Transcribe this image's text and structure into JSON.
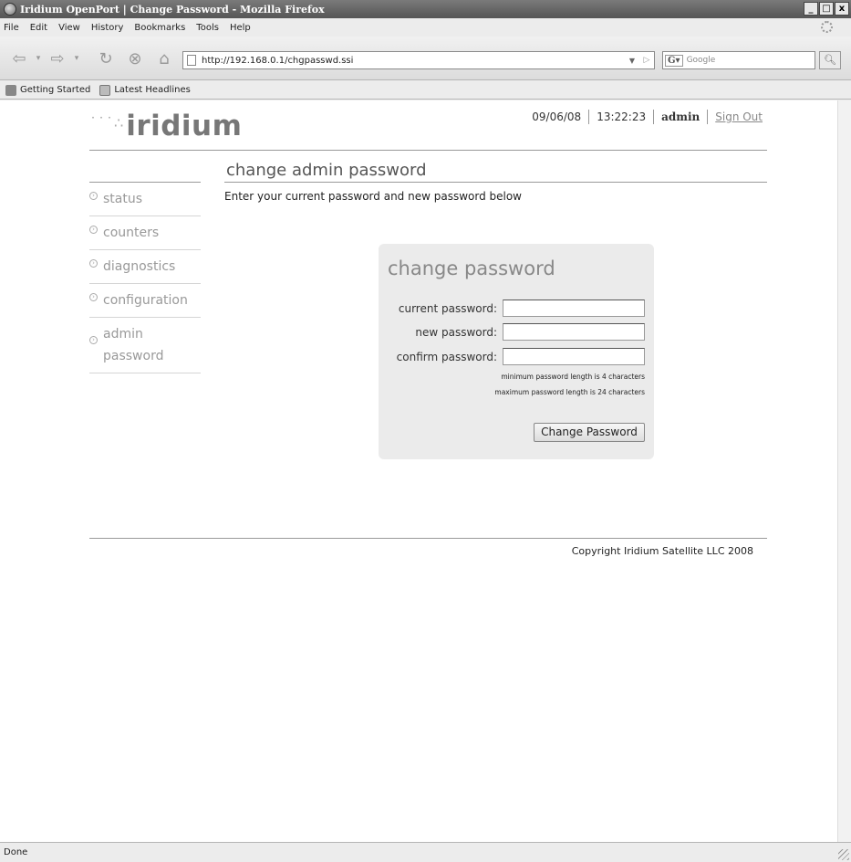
{
  "window": {
    "title": "Iridium OpenPort | Change Password - Mozilla Firefox",
    "controls": {
      "minimize": "_",
      "maximize": "□",
      "close": "x"
    }
  },
  "menu": [
    "File",
    "Edit",
    "View",
    "History",
    "Bookmarks",
    "Tools",
    "Help"
  ],
  "nav": {
    "url": "http://192.168.0.1/chgpasswd.ssi",
    "search_placeholder": "Google"
  },
  "bookmarks": [
    "Getting Started",
    "Latest Headlines"
  ],
  "page": {
    "logo_text": "iridium",
    "date": "09/06/08",
    "time": "13:22:23",
    "user": "admin",
    "sign_out": "Sign Out",
    "heading": "change admin password",
    "intro": "Enter your current password and new password below",
    "sidenav": [
      {
        "label": "status"
      },
      {
        "label": "counters"
      },
      {
        "label": "diagnostics"
      },
      {
        "label": "configuration"
      },
      {
        "label_line1": "admin",
        "label_line2": "password"
      }
    ],
    "form": {
      "title": "change password",
      "current_label": "current password:",
      "new_label": "new password:",
      "confirm_label": "confirm password:",
      "current_value": "",
      "new_value": "",
      "confirm_value": "",
      "min_note": "minimum password length is 4 characters",
      "max_note": "maximum password length is 24 characters",
      "submit": "Change Password"
    },
    "copyright": "Copyright Iridium Satellite LLC 2008"
  },
  "status": "Done"
}
